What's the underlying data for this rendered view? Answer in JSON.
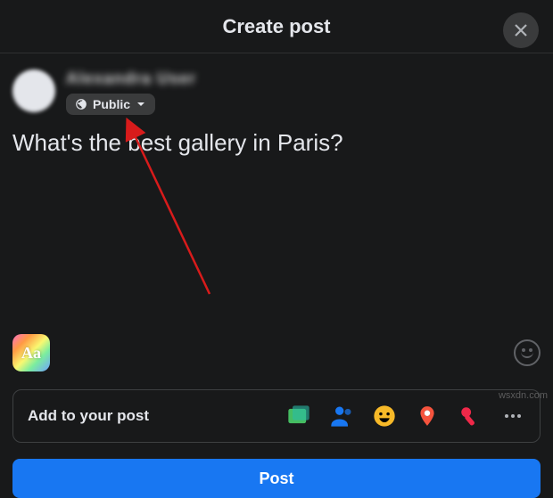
{
  "header": {
    "title": "Create post"
  },
  "user": {
    "name_placeholder": "Alexandra User",
    "audience_label": "Public"
  },
  "composer": {
    "text": "What's the best gallery in Paris?",
    "bg_label": "Aa"
  },
  "addto": {
    "label": "Add to your post"
  },
  "post_button": {
    "label": "Post"
  },
  "watermark": "wsxdn.com"
}
